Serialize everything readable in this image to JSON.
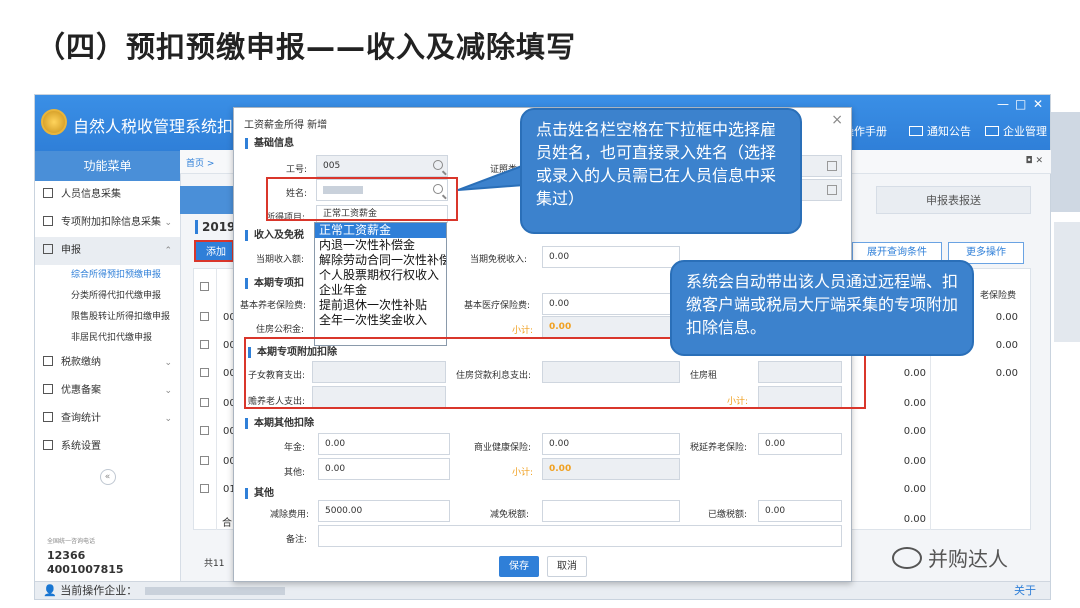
{
  "slide_title": "（四）预扣预缴申报——收入及减除填写",
  "app": {
    "title": "自然人税收管理系统扣缴",
    "header_links": [
      "操作手册",
      "通知公告",
      "企业管理"
    ],
    "window_controls": [
      "—",
      "□",
      "✕"
    ]
  },
  "sidebar": {
    "heading": "功能菜单",
    "items": [
      {
        "label": "人员信息采集"
      },
      {
        "label": "专项附加扣除信息采集"
      },
      {
        "label": "申报"
      }
    ],
    "sub_items": [
      "综合所得预扣预缴申报",
      "分类所得代扣代缴申报",
      "限售股转让所得扣缴申报",
      "非居民代扣代缴申报"
    ],
    "items_after": [
      {
        "label": "税款缴纳"
      },
      {
        "label": "优惠备案"
      },
      {
        "label": "查询统计"
      },
      {
        "label": "系统设置"
      }
    ],
    "collapse_glyph": "«",
    "hotline_caption": "全国统一咨询电话",
    "hotline_1": "12366",
    "hotline_2": "4001007815"
  },
  "breadcrumb": "首页 >",
  "status_bar": {
    "label": "当前操作企业：",
    "about": "关于"
  },
  "main": {
    "year_label": "2019",
    "add_button": "添加",
    "report_tab": "申报表报送",
    "expand_query": "展开查询条件",
    "more_ops": "更多操作",
    "col_head": "老保险费",
    "row_prefixes": [
      "00",
      "00",
      "00",
      "00",
      "00",
      "00",
      "01",
      "00"
    ],
    "right_values": [
      "0.00",
      "0.00",
      "0.00",
      "0.00",
      "0.00",
      "0.00",
      "0.00",
      "0.00",
      "0.00"
    ],
    "total_label": "合",
    "pager": "共11"
  },
  "dialog": {
    "title": "工资薪金所得 新增",
    "close_glyph": "×",
    "sections": {
      "basic": "基础信息",
      "income": "收入及免税",
      "special": "本期专项扣",
      "special_add": "本期专项附加扣除",
      "other": "本期其他扣除",
      "misc": "其他"
    },
    "fields": {
      "id_no_label": "工号:",
      "id_no_value": "005",
      "id_cert_label": "证照类",
      "name_label": "姓名:",
      "income_item_label": "所得项目:",
      "income_item_value": "正常工资薪金",
      "current_income_label": "当期收入额:",
      "tax_free_income_label": "当期免税收入:",
      "tax_free_income_value": "0.00",
      "pension_label": "基本养老保险费:",
      "medical_label": "基本医疗保险费:",
      "medical_value": "0.00",
      "housing_fund_label": "住房公积金:",
      "subtotal_label": "小计:",
      "subtotal_value": "0.00",
      "child_edu_label": "子女教育支出:",
      "housing_loan_label": "住房贷款利息支出:",
      "rent_label": "住房租",
      "elder_label": "赡养老人支出:",
      "special_subtotal_label": "小计:",
      "annuity_label": "年金:",
      "annuity_value": "0.00",
      "commercial_health_label": "商业健康保险:",
      "commercial_health_value": "0.00",
      "tax_deferred_label": "税延养老保险:",
      "tax_deferred_value": "0.00",
      "other_label": "其他:",
      "other_value": "0.00",
      "other_subtotal_label": "小计:",
      "other_subtotal_value": "0.00",
      "deduct_expense_label": "减除费用:",
      "deduct_expense_value": "5000.00",
      "tax_relief_label": "减免税额:",
      "paid_tax_label": "已缴税额:",
      "paid_tax_value": "0.00",
      "remark_label": "备注:"
    },
    "dropdown_options": [
      "正常工资薪金",
      "内退一次性补偿金",
      "解除劳动合同一次性补偿金",
      "个人股票期权行权收入",
      "企业年金",
      "提前退休一次性补贴",
      "全年一次性奖金收入"
    ],
    "save_button": "保存",
    "cancel_button": "取消"
  },
  "callouts": {
    "name_tip": "点击姓名栏空格在下拉框中选择雇员姓名，也可直接录入姓名（选择或录入的人员需已在人员信息中采集过）",
    "special_tip": "系统会自动带出该人员通过远程端、扣缴客户端或税局大厅端采集的专项附加扣除信息。"
  },
  "watermark": "并购达人"
}
